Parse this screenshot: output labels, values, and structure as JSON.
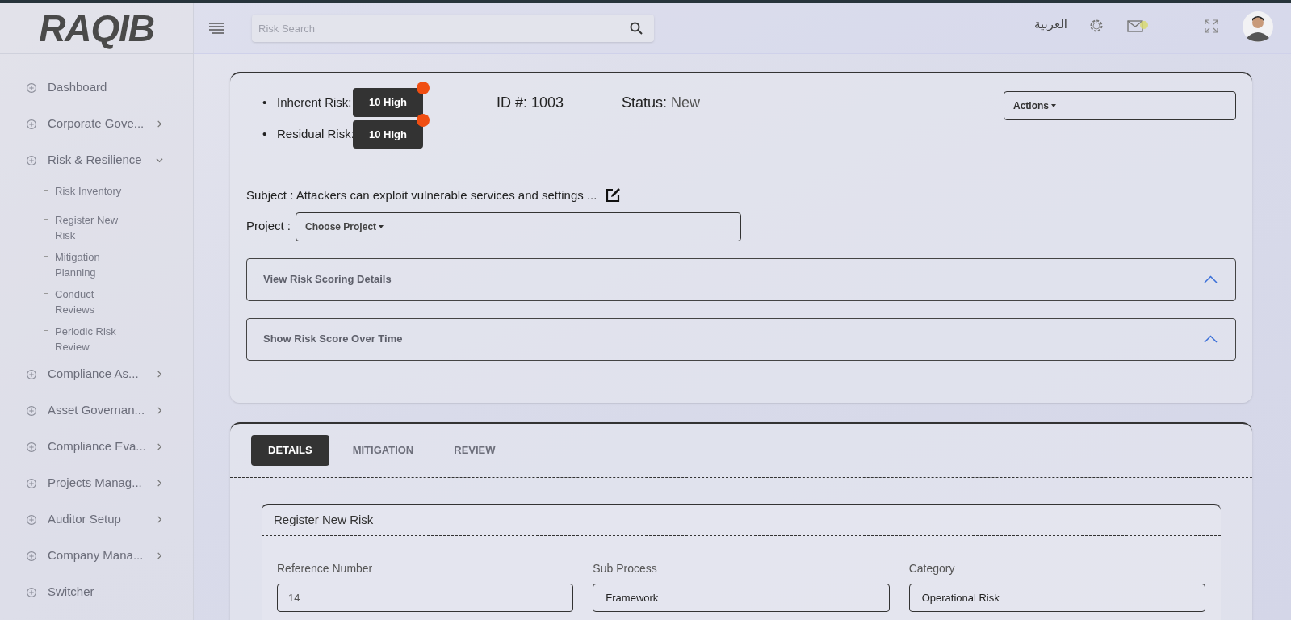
{
  "logo": "RAQIB",
  "search": {
    "placeholder": "Risk Search"
  },
  "header": {
    "language": "العربية"
  },
  "sidebar": {
    "items": [
      {
        "label": "Dashboard",
        "kind": "link"
      },
      {
        "label": "Corporate Gove...",
        "kind": "collapsed"
      },
      {
        "label": "Risk & Resilience",
        "kind": "expanded",
        "children": [
          {
            "label": "Risk Inventory"
          },
          {
            "label": "Register New Risk"
          },
          {
            "label": "Mitigation Planning"
          },
          {
            "label": "Conduct Reviews"
          },
          {
            "label": "Periodic Risk Review"
          }
        ]
      },
      {
        "label": "Compliance As...",
        "kind": "collapsed"
      },
      {
        "label": "Asset Governan...",
        "kind": "collapsed"
      },
      {
        "label": "Compliance Eva...",
        "kind": "collapsed"
      },
      {
        "label": "Projects Manag...",
        "kind": "collapsed"
      },
      {
        "label": "Auditor Setup",
        "kind": "collapsed"
      },
      {
        "label": "Company Mana...",
        "kind": "collapsed"
      },
      {
        "label": "Switcher",
        "kind": "link"
      }
    ]
  },
  "risk": {
    "scores": [
      {
        "marker": "•",
        "label": "Inherent Risk:",
        "value": "10 High",
        "color": "#f04e12"
      },
      {
        "marker": "•",
        "label": "Residual Risk:",
        "value": "10 High",
        "color": "#f04e12"
      }
    ],
    "id_label": "ID #:",
    "id": "1003",
    "status_label": "Status:",
    "status": "New",
    "actions": "Actions",
    "subject_label": "Subject :",
    "subject": "Attackers can exploit vulnerable services and settings ...",
    "project_label": "Project :",
    "project_placeholder": "Choose Project",
    "panels": [
      {
        "title": "View Risk Scoring Details",
        "expanded": true
      },
      {
        "title": "Show Risk Score Over Time",
        "expanded": true
      }
    ]
  },
  "tabs": [
    {
      "label": "DETAILS",
      "selected": true
    },
    {
      "label": "MITIGATION",
      "selected": false
    },
    {
      "label": "REVIEW",
      "selected": false
    }
  ],
  "form": {
    "title": "Register New Risk",
    "fields": [
      {
        "label": "Reference Number",
        "value": "14"
      },
      {
        "label": "Sub Process",
        "value": "Framework"
      },
      {
        "label": "Category",
        "value": "Operational Risk"
      }
    ]
  }
}
